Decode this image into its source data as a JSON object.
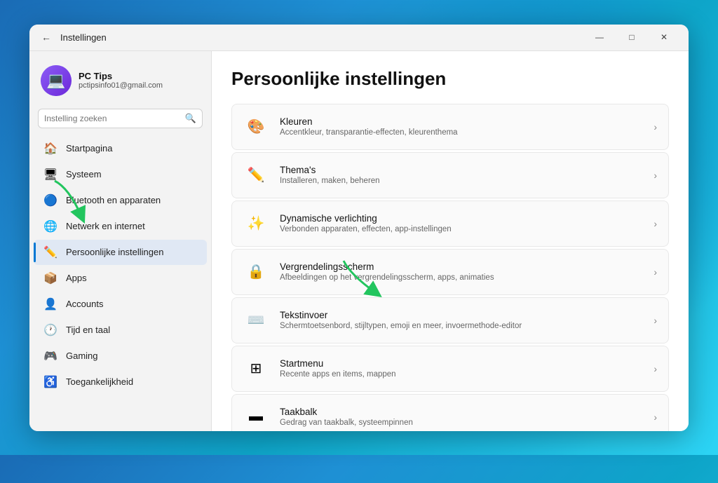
{
  "window": {
    "title": "Instellingen",
    "controls": {
      "minimize": "—",
      "maximize": "□",
      "close": "✕"
    }
  },
  "profile": {
    "name": "PC Tips",
    "email": "pctipsinfo01@gmail.com"
  },
  "search": {
    "placeholder": "Instelling zoeken"
  },
  "sidebar": {
    "items": [
      {
        "id": "startpagina",
        "label": "Startpagina",
        "icon": "🏠"
      },
      {
        "id": "systeem",
        "label": "Systeem",
        "icon": "🖥"
      },
      {
        "id": "bluetooth",
        "label": "Bluetooth en apparaten",
        "icon": "🔵"
      },
      {
        "id": "netwerk",
        "label": "Netwerk en internet",
        "icon": "🌐"
      },
      {
        "id": "personalisatie",
        "label": "Persoonlijke instellingen",
        "icon": "✏️",
        "active": true
      },
      {
        "id": "apps",
        "label": "Apps",
        "icon": "📦"
      },
      {
        "id": "accounts",
        "label": "Accounts",
        "icon": "👤"
      },
      {
        "id": "tijd",
        "label": "Tijd en taal",
        "icon": "🕐"
      },
      {
        "id": "gaming",
        "label": "Gaming",
        "icon": "🎮"
      },
      {
        "id": "toegankelijkheid",
        "label": "Toegankelijkheid",
        "icon": "♿"
      }
    ]
  },
  "page": {
    "title": "Persoonlijke instellingen",
    "settings": [
      {
        "id": "kleuren",
        "title": "Kleuren",
        "desc": "Accentkleur, transparantie-effecten, kleurenthema",
        "icon": "🎨"
      },
      {
        "id": "themas",
        "title": "Thema's",
        "desc": "Installeren, maken, beheren",
        "icon": "✏️"
      },
      {
        "id": "dynamische-verlichting",
        "title": "Dynamische verlichting",
        "desc": "Verbonden apparaten, effecten, app-instellingen",
        "icon": "✨"
      },
      {
        "id": "vergrendelingsscherm",
        "title": "Vergrendelingsscherm",
        "desc": "Afbeeldingen op het vergrendelingsscherm, apps, animaties",
        "icon": "🔒"
      },
      {
        "id": "tekstinvoer",
        "title": "Tekstinvoer",
        "desc": "Schermtoetsenbord, stijltypen, emoji en meer, invoermethode-editor",
        "icon": "⌨️"
      },
      {
        "id": "startmenu",
        "title": "Startmenu",
        "desc": "Recente apps en items, mappen",
        "icon": "⊞"
      },
      {
        "id": "taakbalk",
        "title": "Taakbalk",
        "desc": "Gedrag van taakbalk, systeempinnen",
        "icon": "▬"
      }
    ]
  }
}
